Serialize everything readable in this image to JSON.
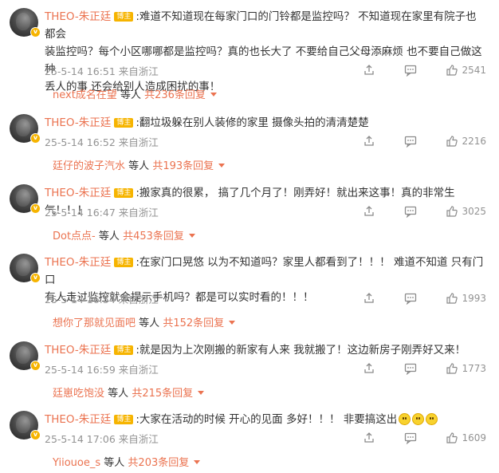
{
  "comments": [
    {
      "author": "THEO-朱正廷",
      "tag": "博主",
      "lines": [
        ":难道不知道现在每家门口的门铃都是监控吗？ 不知道现在家里有院子也都会",
        "装监控吗？每个小区哪哪都是监控吗？真的也长大了 不要给自己父母添麻烦 也不要自己做这种",
        "丢人的事 还会给别人造成困扰的事！"
      ],
      "time": "25-5-14 16:51",
      "location": "来自浙江",
      "likes": "2541",
      "reply_user": "next成名在望",
      "reply_mid": "等人",
      "reply_count": "共236条回复"
    },
    {
      "author": "THEO-朱正廷",
      "tag": "博主",
      "lines": [
        ":翻垃圾躲在别人装修的家里 摄像头拍的清清楚楚"
      ],
      "time": "25-5-14 16:52",
      "location": "来自浙江",
      "likes": "2216",
      "reply_user": "廷仔的波子汽水",
      "reply_mid": "等人",
      "reply_count": "共193条回复"
    },
    {
      "author": "THEO-朱正廷",
      "tag": "博主",
      "lines": [
        ":搬家真的很累， 搞了几个月了！刚弄好！就出来这事！真的非常生气！！！"
      ],
      "time": "25-5-14 16:47",
      "location": "来自浙江",
      "likes": "3025",
      "reply_user": "Dot点点-",
      "reply_mid": "等人",
      "reply_count": "共453条回复"
    },
    {
      "author": "THEO-朱正廷",
      "tag": "博主",
      "lines": [
        ":在家门口晃悠 以为不知道吗？家里人都看到了！！！ 难道不知道 只有门口",
        "有人走过监控就会提示手机吗？都是可以实时看的！！！"
      ],
      "time": "25-5-14 16:54",
      "location": "来自浙江",
      "likes": "1993",
      "reply_user": "想你了那就见面吧",
      "reply_mid": "等人",
      "reply_count": "共152条回复"
    },
    {
      "author": "THEO-朱正廷",
      "tag": "博主",
      "lines": [
        ":就是因为上次刚搬的新家有人来 我就搬了！这边新房子刚弄好又来！"
      ],
      "time": "25-5-14 16:59",
      "location": "来自浙江",
      "likes": "1773",
      "reply_user": "廷崽吃饱没",
      "reply_mid": "等人",
      "reply_count": "共215条回复"
    },
    {
      "author": "THEO-朱正廷",
      "tag": "博主",
      "lines": [
        ":大家在活动的时候 开心的见面 多好！！！ 非要搞这出"
      ],
      "emoji": "smile",
      "time": "25-5-14 17:06",
      "location": "来自浙江",
      "likes": "1609",
      "reply_user": "Yiiouoe_s",
      "reply_mid": "等人",
      "reply_count": "共203条回复"
    }
  ],
  "icons": {
    "share": "share-icon",
    "reply": "comment-icon",
    "like": "thumbs-up-icon",
    "verified": "verified-badge-icon",
    "emoji": "smiley-emoji"
  },
  "colors": {
    "author": "#eb7350",
    "tag": "#f6b400",
    "meta": "#939393"
  }
}
